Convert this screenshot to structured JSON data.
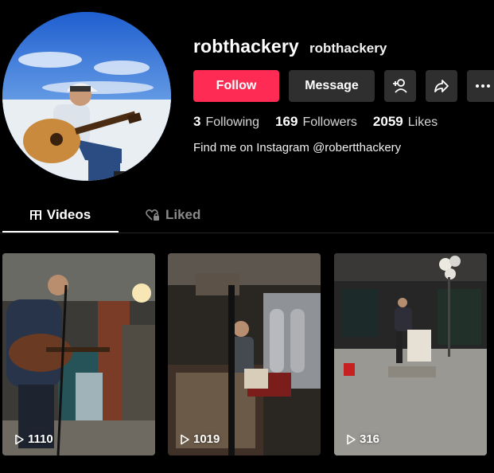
{
  "profile": {
    "username": "robthackery",
    "nickname": "robthackery",
    "bio": "Find me on Instagram @robertthackery"
  },
  "actions": {
    "follow_label": "Follow",
    "message_label": "Message",
    "add_friend_icon": "add-user-icon",
    "share_icon": "share-icon",
    "more_icon": "more-icon"
  },
  "stats": {
    "following": {
      "count": "3",
      "label": "Following"
    },
    "followers": {
      "count": "169",
      "label": "Followers"
    },
    "likes": {
      "count": "2059",
      "label": "Likes"
    }
  },
  "tabs": [
    {
      "label": "Videos",
      "icon": "grid-icon",
      "active": true
    },
    {
      "label": "Liked",
      "icon": "heart-lock-icon",
      "active": false
    }
  ],
  "videos": [
    {
      "views": "1110"
    },
    {
      "views": "1019"
    },
    {
      "views": "316"
    }
  ],
  "colors": {
    "accent": "#fe2c55",
    "button_bg": "#2f2f2f",
    "background": "#000000"
  }
}
